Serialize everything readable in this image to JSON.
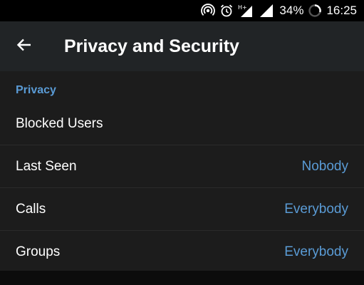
{
  "status_bar": {
    "battery_percent": "34%",
    "time": "16:25",
    "network_type": "H+",
    "icons": [
      "hotspot-icon",
      "alarm-icon",
      "signal-icon",
      "signal-icon",
      "battery-ring-icon"
    ]
  },
  "app_bar": {
    "back_icon": "arrow-left-icon",
    "title": "Privacy and Security"
  },
  "sections": {
    "privacy": {
      "header": "Privacy",
      "items": [
        {
          "label": "Blocked Users",
          "value": ""
        },
        {
          "label": "Last Seen",
          "value": "Nobody"
        },
        {
          "label": "Calls",
          "value": "Everybody"
        },
        {
          "label": "Groups",
          "value": "Everybody"
        }
      ]
    }
  },
  "colors": {
    "accent": "#5a9bd5",
    "app_bar": "#212426",
    "background": "#1c1c1c",
    "text": "#ffffff"
  }
}
